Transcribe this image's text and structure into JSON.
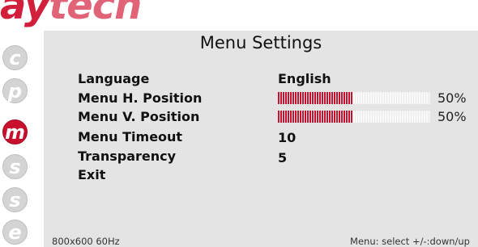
{
  "logo": {
    "text_main": "ay",
    "text_rest": "tech"
  },
  "sidebar": {
    "items": [
      {
        "letter": "c",
        "active": false
      },
      {
        "letter": "p",
        "active": false
      },
      {
        "letter": "m",
        "active": true
      },
      {
        "letter": "s",
        "active": false
      },
      {
        "letter": "s",
        "active": false
      },
      {
        "letter": "e",
        "active": false
      }
    ]
  },
  "menu": {
    "title": "Menu Settings",
    "items": [
      {
        "label": "Language",
        "value": "English"
      },
      {
        "label": "Menu H. Position",
        "level": 50,
        "percent": "50%"
      },
      {
        "label": "Menu V. Position",
        "level": 50,
        "percent": "50%"
      },
      {
        "label": "Menu Timeout",
        "value": "10"
      },
      {
        "label": "Transparency",
        "value": "5"
      },
      {
        "label": "Exit"
      }
    ]
  },
  "footer": {
    "resolution": "800x600 60Hz",
    "help": "Menu: select +/-:down/up"
  },
  "colors": {
    "accent": "#c8102e",
    "panel": "#e4e4e4",
    "bar_fill": "#c8102e",
    "bar_empty": "#ffffff"
  }
}
